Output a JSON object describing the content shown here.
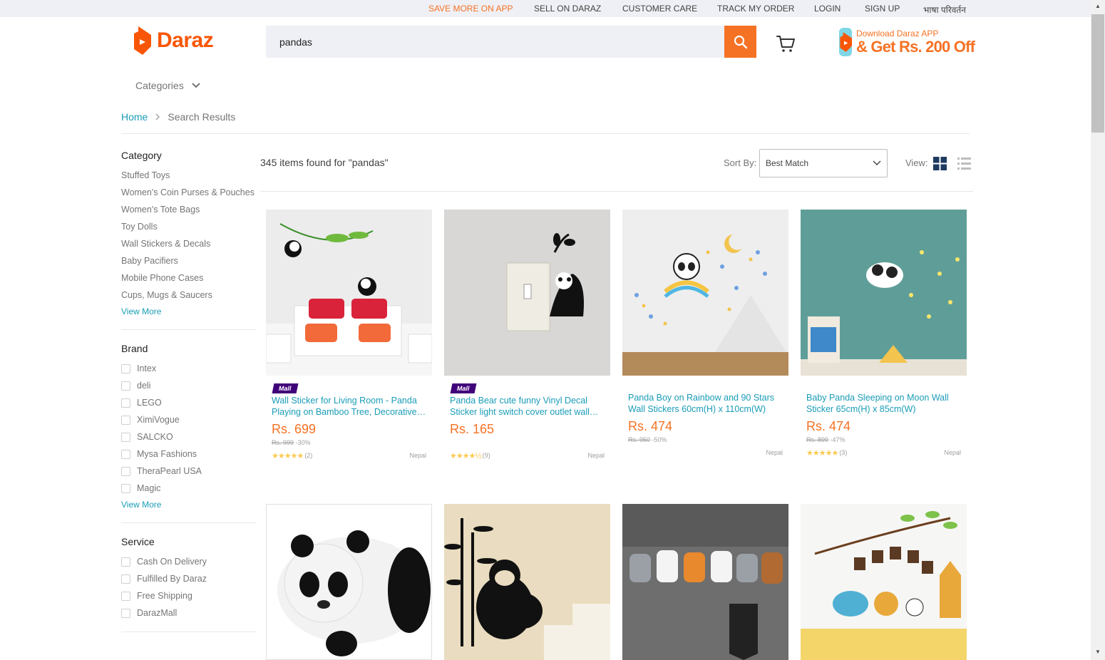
{
  "topbar": {
    "save_more": "SAVE MORE ON APP",
    "sell": "SELL ON DARAZ",
    "care": "CUSTOMER CARE",
    "track": "TRACK MY ORDER",
    "login": "LOGIN",
    "signup": "SIGN UP",
    "language": "भाषा परिवर्तन"
  },
  "header": {
    "logo_text": "Daraz",
    "search_value": "pandas",
    "app_promo_line1": "Download Daraz APP",
    "app_promo_line2": "& Get Rs. 200 Off",
    "categories_label": "Categories"
  },
  "breadcrumb": {
    "home": "Home",
    "current": "Search Results"
  },
  "sidebar": {
    "category_title": "Category",
    "categories": [
      "Stuffed Toys",
      "Women's Coin Purses & Pouches",
      "Women's Tote Bags",
      "Toy Dolls",
      "Wall Stickers & Decals",
      "Baby Pacifiers",
      "Mobile Phone Cases",
      "Cups, Mugs & Saucers"
    ],
    "category_view_more": "View More",
    "brand_title": "Brand",
    "brands": [
      "Intex",
      "deli",
      "LEGO",
      "XimiVogue",
      "SALCKO",
      "Mysa Fashions",
      "TheraPearl USA",
      "Magic"
    ],
    "brand_view_more": "View More",
    "service_title": "Service",
    "services": [
      "Cash On Delivery",
      "Fulfilled By Daraz",
      "Free Shipping",
      "DarazMall"
    ]
  },
  "results": {
    "count_text": "345 items found for \"pandas\"",
    "sort_label": "Sort By:",
    "sort_value": "Best Match",
    "view_label": "View:"
  },
  "products": [
    {
      "mall": "Mall",
      "title": "Wall Sticker for Living Room - Panda Playing on Bamboo Tree, Decorative Vinyl Wall Decal",
      "price": "Rs. 699",
      "original": "Rs. 999",
      "discount": "-30%",
      "rating": 5,
      "stars": "★★★★★",
      "reviews": "(2)",
      "origin": "Nepal"
    },
    {
      "mall": "Mall",
      "title": "Panda Bear cute funny Vinyl Decal Sticker light switch cover outlet wall decor",
      "price": "Rs. 165",
      "original": "",
      "discount": "",
      "rating": 4.5,
      "stars": "★★★★½",
      "reviews": "(9)",
      "origin": "Nepal"
    },
    {
      "mall": "",
      "title": "Panda Boy on Rainbow and 90 Stars Wall Stickers 60cm(H) x 110cm(W)",
      "price": "Rs. 474",
      "original": "Rs. 950",
      "discount": "-50%",
      "rating": 0,
      "stars": "",
      "reviews": "",
      "origin": "Nepal"
    },
    {
      "mall": "",
      "title": "Baby Panda Sleeping on Moon Wall Sticker 65cm(H) x 85cm(W)",
      "price": "Rs. 474",
      "original": "Rs. 899",
      "discount": "-47%",
      "rating": 5,
      "stars": "★★★★★",
      "reviews": "(3)",
      "origin": "Nepal"
    }
  ],
  "colors": {
    "accent": "#f57224",
    "link": "#1a9cb7",
    "mall_badge": "#40017a",
    "topbar_bg": "#eff0f5"
  }
}
